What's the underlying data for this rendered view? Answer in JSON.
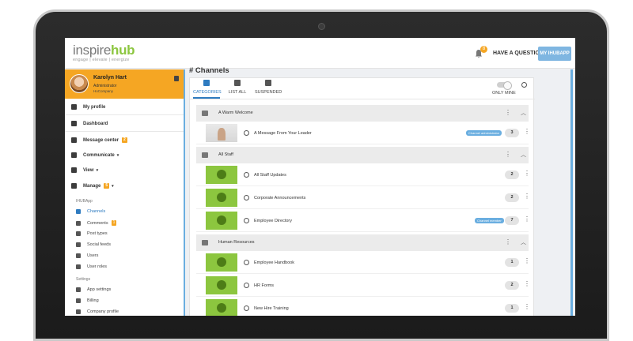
{
  "header": {
    "logo_text_a": "inspire",
    "logo_text_b": "hub",
    "logo_tagline": "engage  |  elevate  |  energize",
    "notification_count": "8",
    "help_label": "HAVE A QUESTION?",
    "app_button_label": "MY IHUBAPP"
  },
  "profile": {
    "name": "Karolyn Hart",
    "role": "Administrator",
    "company": "HoCompany"
  },
  "nav": {
    "my_profile": "My profile",
    "dashboard": "Dashboard",
    "message_center": "Message center",
    "message_center_badge": "2",
    "communicate": "Communicate",
    "view": "View",
    "manage": "Manage",
    "manage_badge": "5"
  },
  "ihubapp": {
    "heading": "IHUBApp",
    "channels": "Channels",
    "comments": "Comments",
    "comments_badge": "1",
    "post_types": "Post types",
    "social_feeds": "Social feeds",
    "users": "Users",
    "user_roles": "User roles"
  },
  "settings": {
    "heading": "Settings",
    "app_settings": "App settings",
    "billing": "Billing",
    "company_profile": "Company profile"
  },
  "page": {
    "title": "# Channels"
  },
  "tabs": {
    "categories": "CATEGORIES",
    "list_all": "LIST ALL",
    "suspended": "SUSPENDED",
    "only_mine": "ONLY MINE"
  },
  "categories": [
    {
      "name": "A Warm Welcome",
      "channels": [
        {
          "name": "A Message From Your Leader",
          "tag": "Channel administrator",
          "count": "3",
          "thumb": "photo"
        }
      ]
    },
    {
      "name": "All Staff",
      "channels": [
        {
          "name": "All Staff Updates",
          "tag": "",
          "count": "2",
          "thumb": "green"
        },
        {
          "name": "Corporate Announcements",
          "tag": "",
          "count": "2",
          "thumb": "green"
        },
        {
          "name": "Employee Directory",
          "tag": "Channel member",
          "count": "7",
          "thumb": "green"
        }
      ]
    },
    {
      "name": "Human Resources",
      "channels": [
        {
          "name": "Employee Handbook",
          "tag": "",
          "count": "1",
          "thumb": "green"
        },
        {
          "name": "HR Forms",
          "tag": "",
          "count": "2",
          "thumb": "green"
        },
        {
          "name": "New Hire Training",
          "tag": "",
          "count": "1",
          "thumb": "green"
        }
      ]
    }
  ]
}
